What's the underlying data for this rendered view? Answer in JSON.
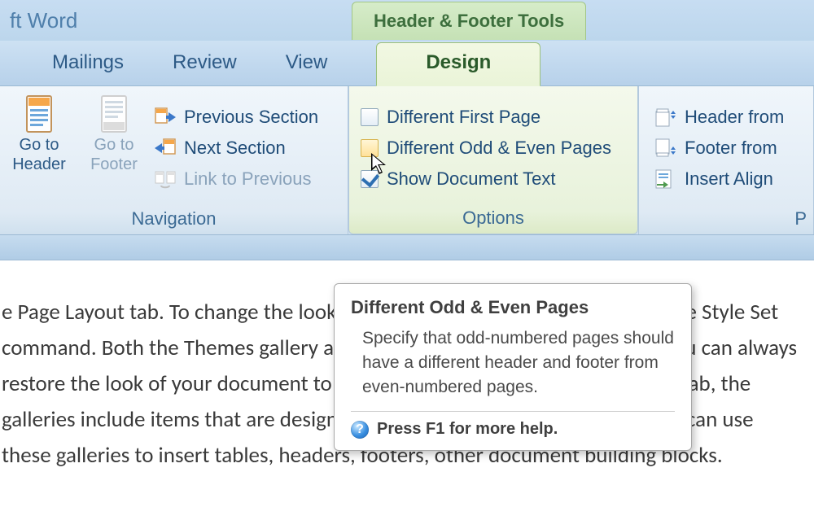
{
  "title": {
    "app": "ft Word",
    "context": "Header & Footer Tools"
  },
  "tabs": {
    "mailings": "Mailings",
    "review": "Review",
    "view": "View",
    "design": "Design"
  },
  "nav_group": {
    "label": "Navigation",
    "go_to_header_1": "Go to",
    "go_to_header_2": "Header",
    "go_to_footer_1": "Go to",
    "go_to_footer_2": "Footer",
    "prev_section": "Previous Section",
    "next_section": "Next Section",
    "link_to_previous": "Link to Previous"
  },
  "options_group": {
    "label": "Options",
    "diff_first": "Different First Page",
    "diff_odd_even": "Different Odd & Even Pages",
    "show_doc_text": "Show Document Text"
  },
  "position_group": {
    "label": "P",
    "header_from": "Header from",
    "footer_from": "Footer from",
    "insert_align": "Insert Align"
  },
  "document": {
    "text": "e Page Layout tab. To change the look of your document in the gallery, use the Style Set command. Both the Themes gallery and the Quick Styles gallery provide it you can always restore the look of your document to the original contained in  On the Insert tab, the galleries include items that are designed to coordinate f your document. You can use these galleries to insert tables, headers, footers, other document building blocks."
  },
  "tooltip": {
    "title": "Different Odd & Even Pages",
    "body": "Specify that odd-numbered pages should have a different header and footer from even-numbered pages.",
    "help": "Press F1 for more help."
  }
}
